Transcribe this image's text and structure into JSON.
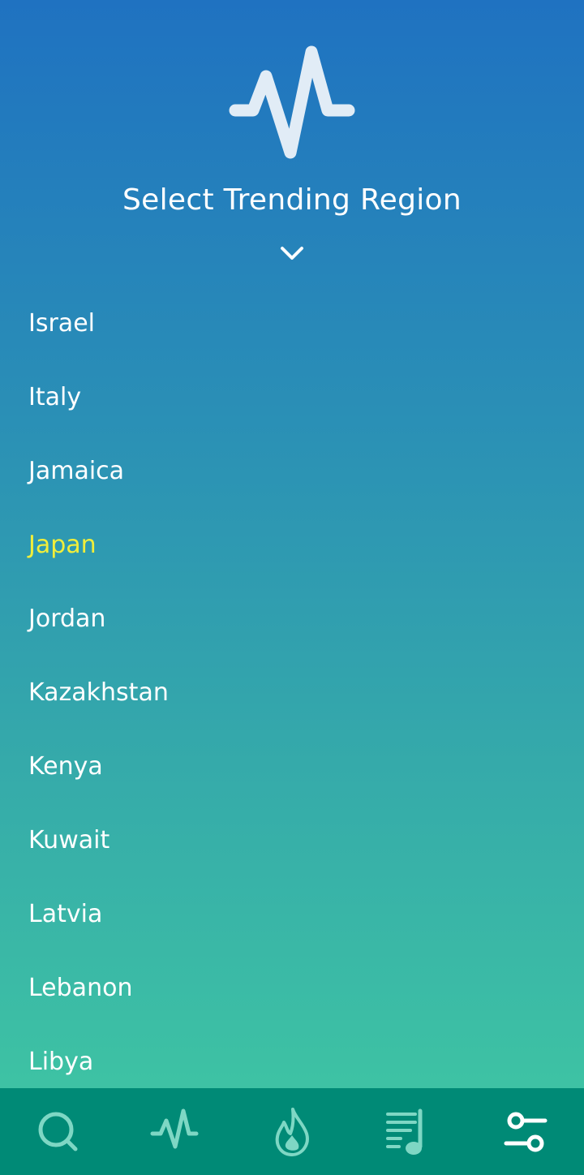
{
  "header": {
    "logo_icon": "pulse-icon",
    "title": "Select Trending Region",
    "expand_icon": "chevron-down-icon"
  },
  "regions": {
    "items": [
      {
        "label": "Israel",
        "selected": false
      },
      {
        "label": "Italy",
        "selected": false
      },
      {
        "label": "Jamaica",
        "selected": false
      },
      {
        "label": "Japan",
        "selected": true
      },
      {
        "label": "Jordan",
        "selected": false
      },
      {
        "label": "Kazakhstan",
        "selected": false
      },
      {
        "label": "Kenya",
        "selected": false
      },
      {
        "label": "Kuwait",
        "selected": false
      },
      {
        "label": "Latvia",
        "selected": false
      },
      {
        "label": "Lebanon",
        "selected": false
      },
      {
        "label": "Libya",
        "selected": false
      }
    ]
  },
  "bottom_nav": {
    "items": [
      {
        "icon": "search-icon",
        "active": false
      },
      {
        "icon": "pulse-icon",
        "active": false
      },
      {
        "icon": "flame-icon",
        "active": false
      },
      {
        "icon": "playlist-icon",
        "active": false
      },
      {
        "icon": "sliders-icon",
        "active": true
      }
    ]
  },
  "colors": {
    "gradient_top": "#1F72C1",
    "gradient_bottom": "#40C9A2",
    "selected_text": "#F1EE3A",
    "nav_background": "#008A76",
    "nav_icon_inactive": "#7ED7C4",
    "nav_icon_active": "#FFFFFF"
  }
}
